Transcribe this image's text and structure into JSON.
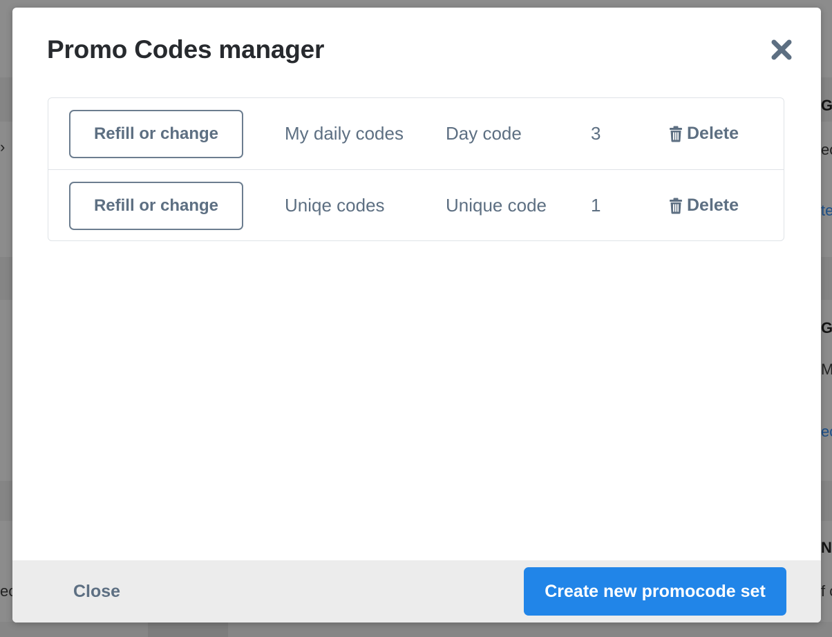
{
  "modal": {
    "title": "Promo Codes manager"
  },
  "codes": [
    {
      "action_label": "Refill or change",
      "name": "My daily codes",
      "type": "Day code",
      "count": "3",
      "delete_label": "Delete"
    },
    {
      "action_label": "Refill or change",
      "name": "Uniqe codes",
      "type": "Unique code",
      "count": "1",
      "delete_label": "Delete"
    }
  ],
  "footer": {
    "close_label": "Close",
    "create_label": "Create new promocode set"
  },
  "background_fragments": {
    "chevron": "›",
    "frag1": "GI",
    "frag2": "ec",
    "frag3": "te",
    "frag4": "GL",
    "frag5": "Ma",
    "frag6": "ec",
    "frag7": "N",
    "frag8": "f c",
    "frag9": "ec"
  },
  "colors": {
    "primary": "#2185e8",
    "text_muted": "#5d6f82",
    "title": "#272a2e",
    "footer_bg": "#ececec",
    "overlay": "#8c8c8c"
  },
  "icons": {
    "close": "close-x-icon",
    "delete": "trash-icon"
  }
}
